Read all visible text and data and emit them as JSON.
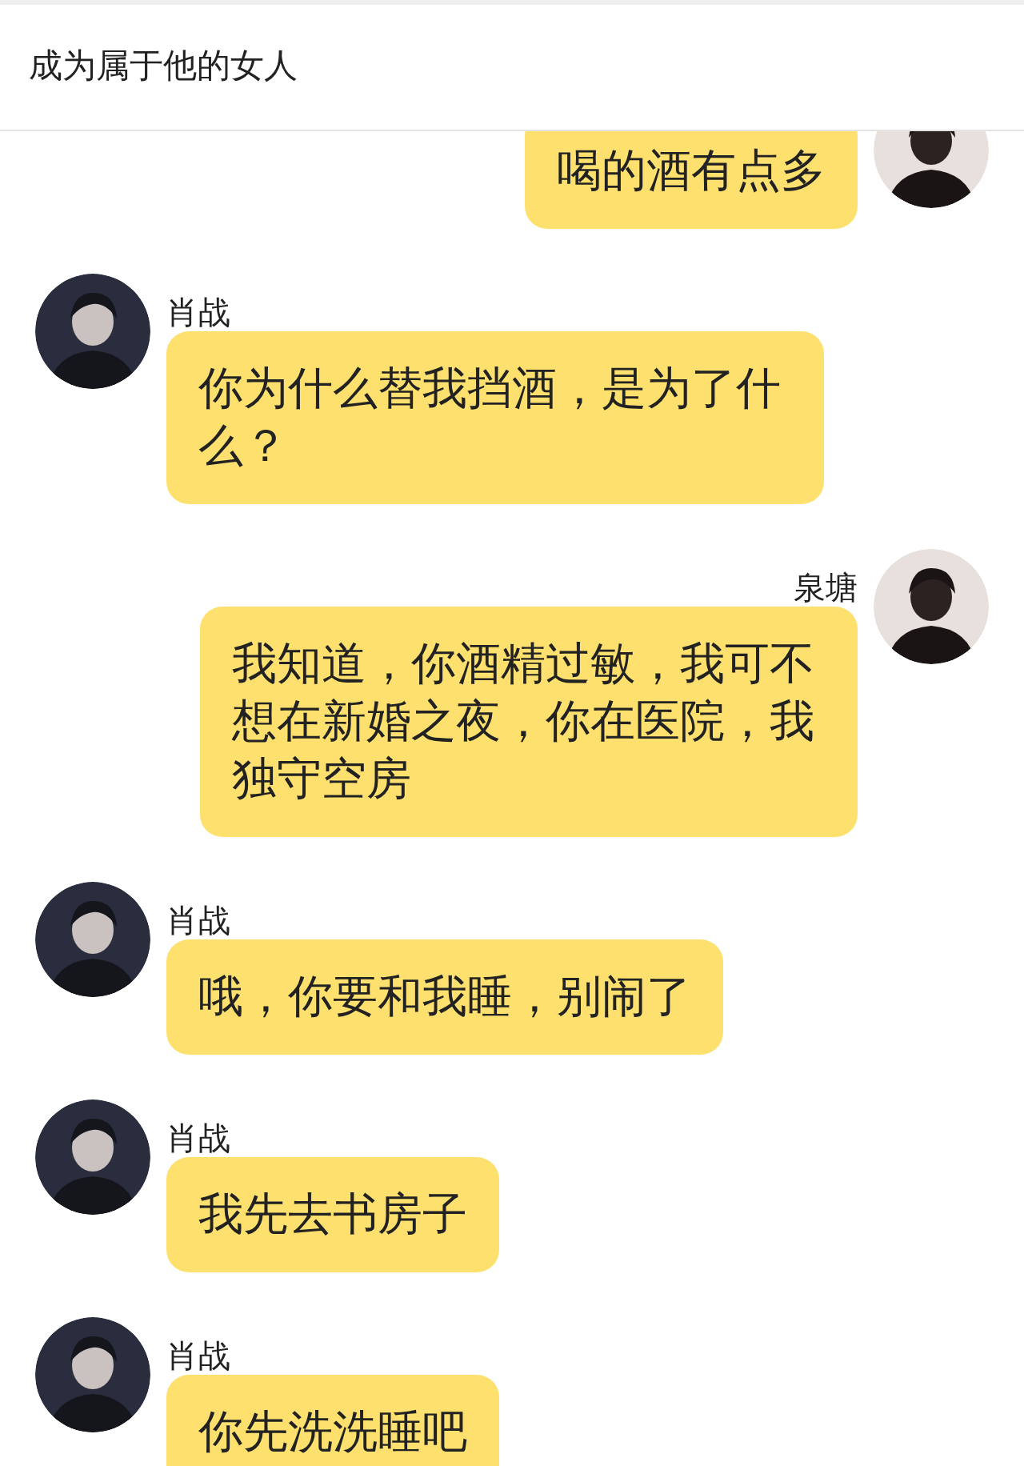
{
  "header": {
    "title": "成为属于他的女人"
  },
  "messages": [
    {
      "kind": "outgoing",
      "text": "喝的酒有点多"
    },
    {
      "kind": "incoming",
      "sender": "肖战",
      "text": "你为什么替我挡酒，是为了什么？"
    },
    {
      "kind": "outgoing",
      "sender": "泉塘",
      "text": "我知道，你酒精过敏，我可不想在新婚之夜，你在医院，我独守空房"
    },
    {
      "kind": "incoming",
      "sender": "肖战",
      "text": "哦，你要和我睡，别闹了"
    },
    {
      "kind": "incoming",
      "sender": "肖战",
      "text": "我先去书房子"
    },
    {
      "kind": "incoming",
      "sender": "肖战",
      "text": "你先洗洗睡吧"
    }
  ]
}
